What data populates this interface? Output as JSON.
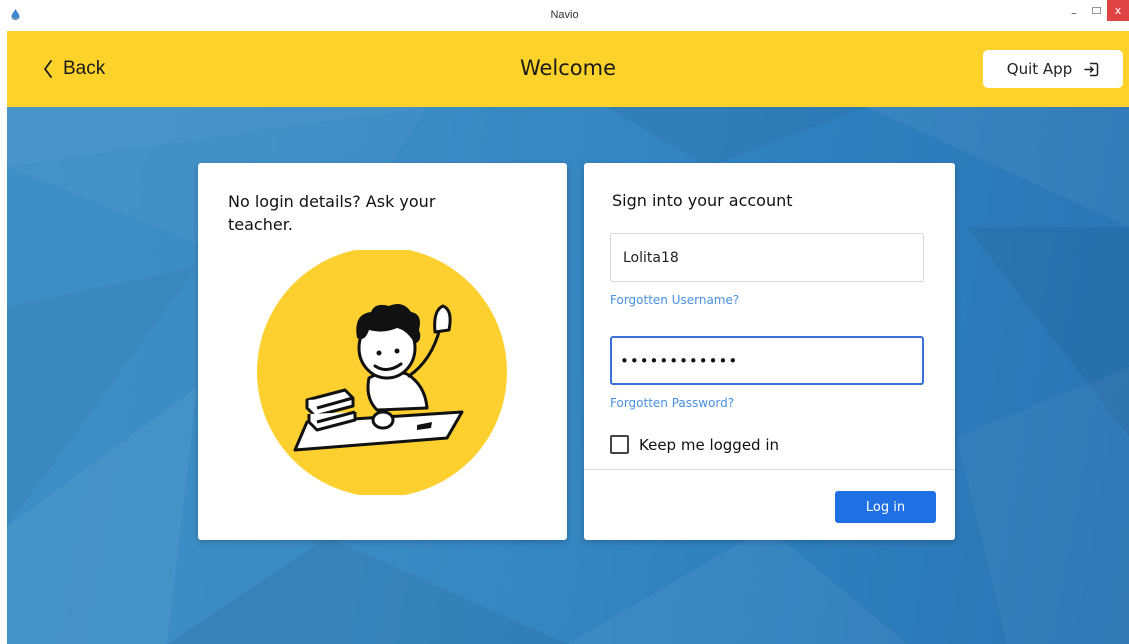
{
  "window": {
    "title": "Navio",
    "minimize_glyph": "–",
    "close_glyph": "x"
  },
  "header": {
    "back_label": "Back",
    "title": "Welcome",
    "quit_label": "Quit App",
    "background_color": "#fdd22b"
  },
  "info_card": {
    "heading": "No login details? Ask your teacher."
  },
  "login_card": {
    "heading": "Sign into your account",
    "username_value": "Lolita18",
    "forgot_username": "Forgotten Username?",
    "password_value": "••••••••••••",
    "forgot_password": "Forgotten Password?",
    "keep_logged_in_label": "Keep me logged in",
    "keep_logged_in_checked": false,
    "login_button": "Log in"
  },
  "colors": {
    "accent_blue": "#1f6fe5",
    "link_blue": "#4a90e2",
    "background_blue": "#3a8bc4"
  }
}
